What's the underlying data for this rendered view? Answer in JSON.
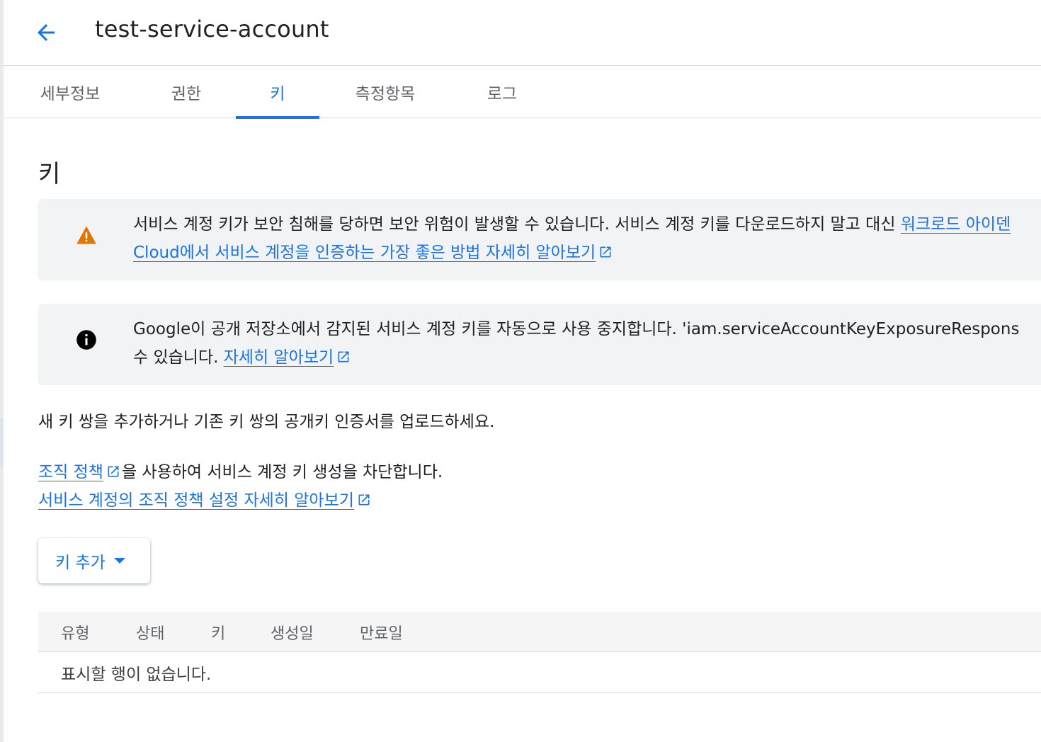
{
  "header": {
    "title": "test-service-account",
    "back_icon": "arrow-left-icon"
  },
  "tabs": [
    {
      "label": "세부정보",
      "active": false
    },
    {
      "label": "권한",
      "active": false
    },
    {
      "label": "키",
      "active": true
    },
    {
      "label": "측정항목",
      "active": false
    },
    {
      "label": "로그",
      "active": false
    }
  ],
  "section": {
    "title": "키"
  },
  "warning": {
    "icon": "warning-triangle-icon",
    "text1": "서비스 계정 키가 보안 침해를 당하면 보안 위험이 발생할 수 있습니다. 서비스 계정 키를 다운로드하지 말고 대신 ",
    "link1": "워크로드 아이덴",
    "link2": "Cloud에서 서비스 계정을 인증하는 가장 좋은 방법 자세히 알아보기"
  },
  "info": {
    "icon": "info-circle-icon",
    "text1": "Google이 공개 저장소에서 감지된 서비스 계정 키를 자동으로 사용 중지합니다. 'iam.serviceAccountKeyExposureRespons",
    "text2": "수 있습니다. ",
    "link": "자세히 알아보기"
  },
  "description": "새 키 쌍을 추가하거나 기존 키 쌍의 공개키 인증서를 업로드하세요.",
  "policy": {
    "link1": "조직 정책",
    "text1": "을 사용하여 서비스 계정 키 생성을 차단합니다.",
    "link2": "서비스 계정의 조직 정책 설정 자세히 알아보기"
  },
  "add_key_button": {
    "label": "키 추가"
  },
  "table": {
    "columns": [
      "유형",
      "상태",
      "키",
      "생성일",
      "만료일"
    ],
    "empty_message": "표시할 행이 없습니다."
  },
  "colors": {
    "accent": "#1a73e8",
    "warning": "#e37400",
    "notice_bg": "#f1f3f4"
  }
}
